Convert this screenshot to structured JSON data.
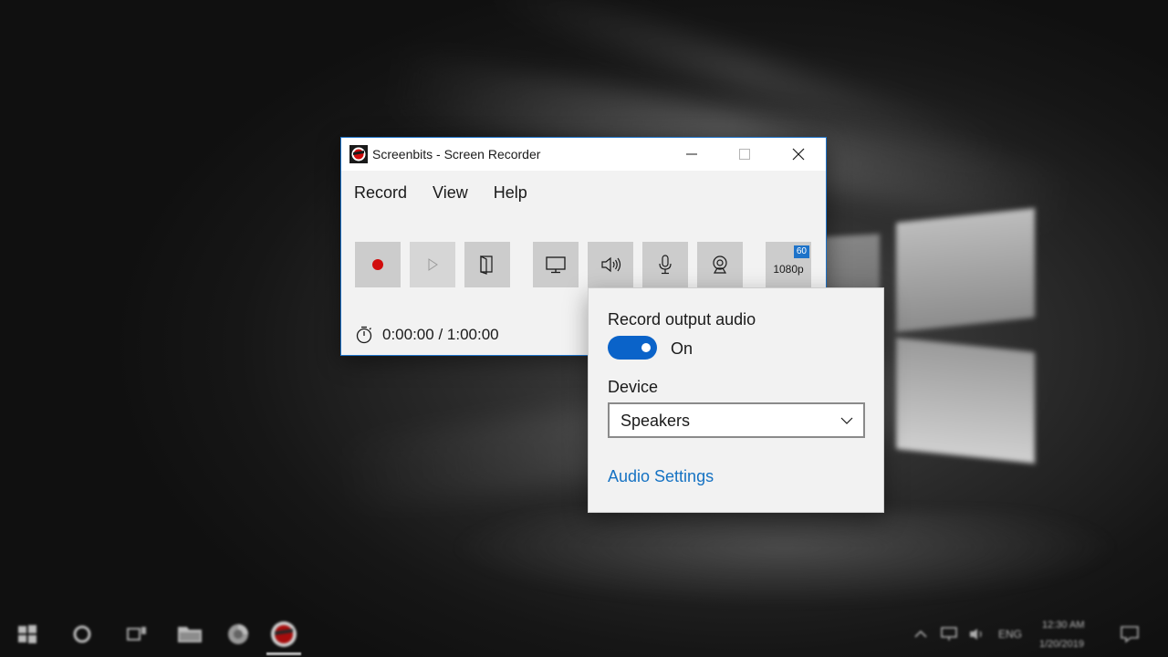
{
  "window": {
    "title": "Screenbits - Screen Recorder",
    "controls": [
      "minimize-icon",
      "maximize-icon",
      "close-icon"
    ]
  },
  "menu": {
    "items": [
      {
        "label": "Record"
      },
      {
        "label": "View"
      },
      {
        "label": "Help"
      }
    ]
  },
  "toolbar": {
    "record": {
      "icon": "record-icon",
      "color": "#d10c0c"
    },
    "play": {
      "icon": "play-icon",
      "disabled": true
    },
    "folder": {
      "icon": "folder-icon"
    },
    "screen": {
      "icon": "monitor-icon"
    },
    "audio": {
      "icon": "speaker-icon"
    },
    "microphone": {
      "icon": "microphone-icon"
    },
    "webcam": {
      "icon": "webcam-icon"
    },
    "resolution": {
      "label": "1080p",
      "fps_badge": "60"
    }
  },
  "timer": {
    "icon": "stopwatch-icon",
    "text": "0:00:00 / 1:00:00"
  },
  "audio_flyout": {
    "heading": "Record output audio",
    "toggle_state": "On",
    "toggle_on": true,
    "device_label": "Device",
    "device_value": "Speakers",
    "settings_link": "Audio Settings"
  },
  "taskbar": {
    "language": "ENG",
    "time": "12:30 AM",
    "date": "1/20/2019"
  },
  "colors": {
    "accent": "#1e73c9",
    "toggle": "#0a63c9",
    "link": "#1572c3",
    "record": "#d10c0c"
  }
}
